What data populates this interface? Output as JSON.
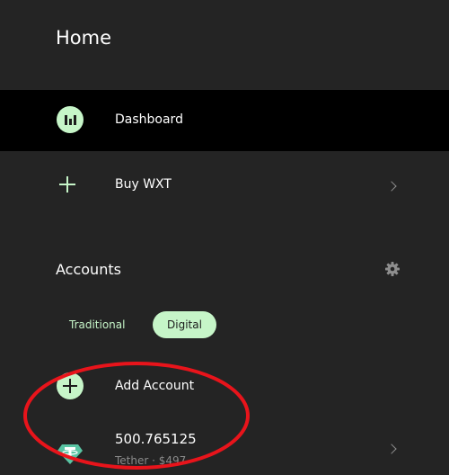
{
  "header": {
    "title": "Home"
  },
  "nav": {
    "dashboard": {
      "label": "Dashboard",
      "icon": "chart-bars-icon"
    },
    "buy": {
      "label": "Buy WXT",
      "icon": "plus-icon"
    }
  },
  "accounts": {
    "title": "Accounts",
    "settings_icon": "gear-icon",
    "tabs": [
      {
        "label": "Traditional",
        "selected": false
      },
      {
        "label": "Digital",
        "selected": true
      }
    ],
    "add_account": {
      "label": "Add Account",
      "icon": "plus-circle-icon"
    },
    "items": [
      {
        "balance": "500.765125",
        "subtitle": "Tether · $497",
        "icon": "tether-icon"
      }
    ]
  },
  "colors": {
    "accent": "#c6f5c8",
    "background": "#242424",
    "selected_row": "#000000",
    "highlight": "#e8141b"
  }
}
